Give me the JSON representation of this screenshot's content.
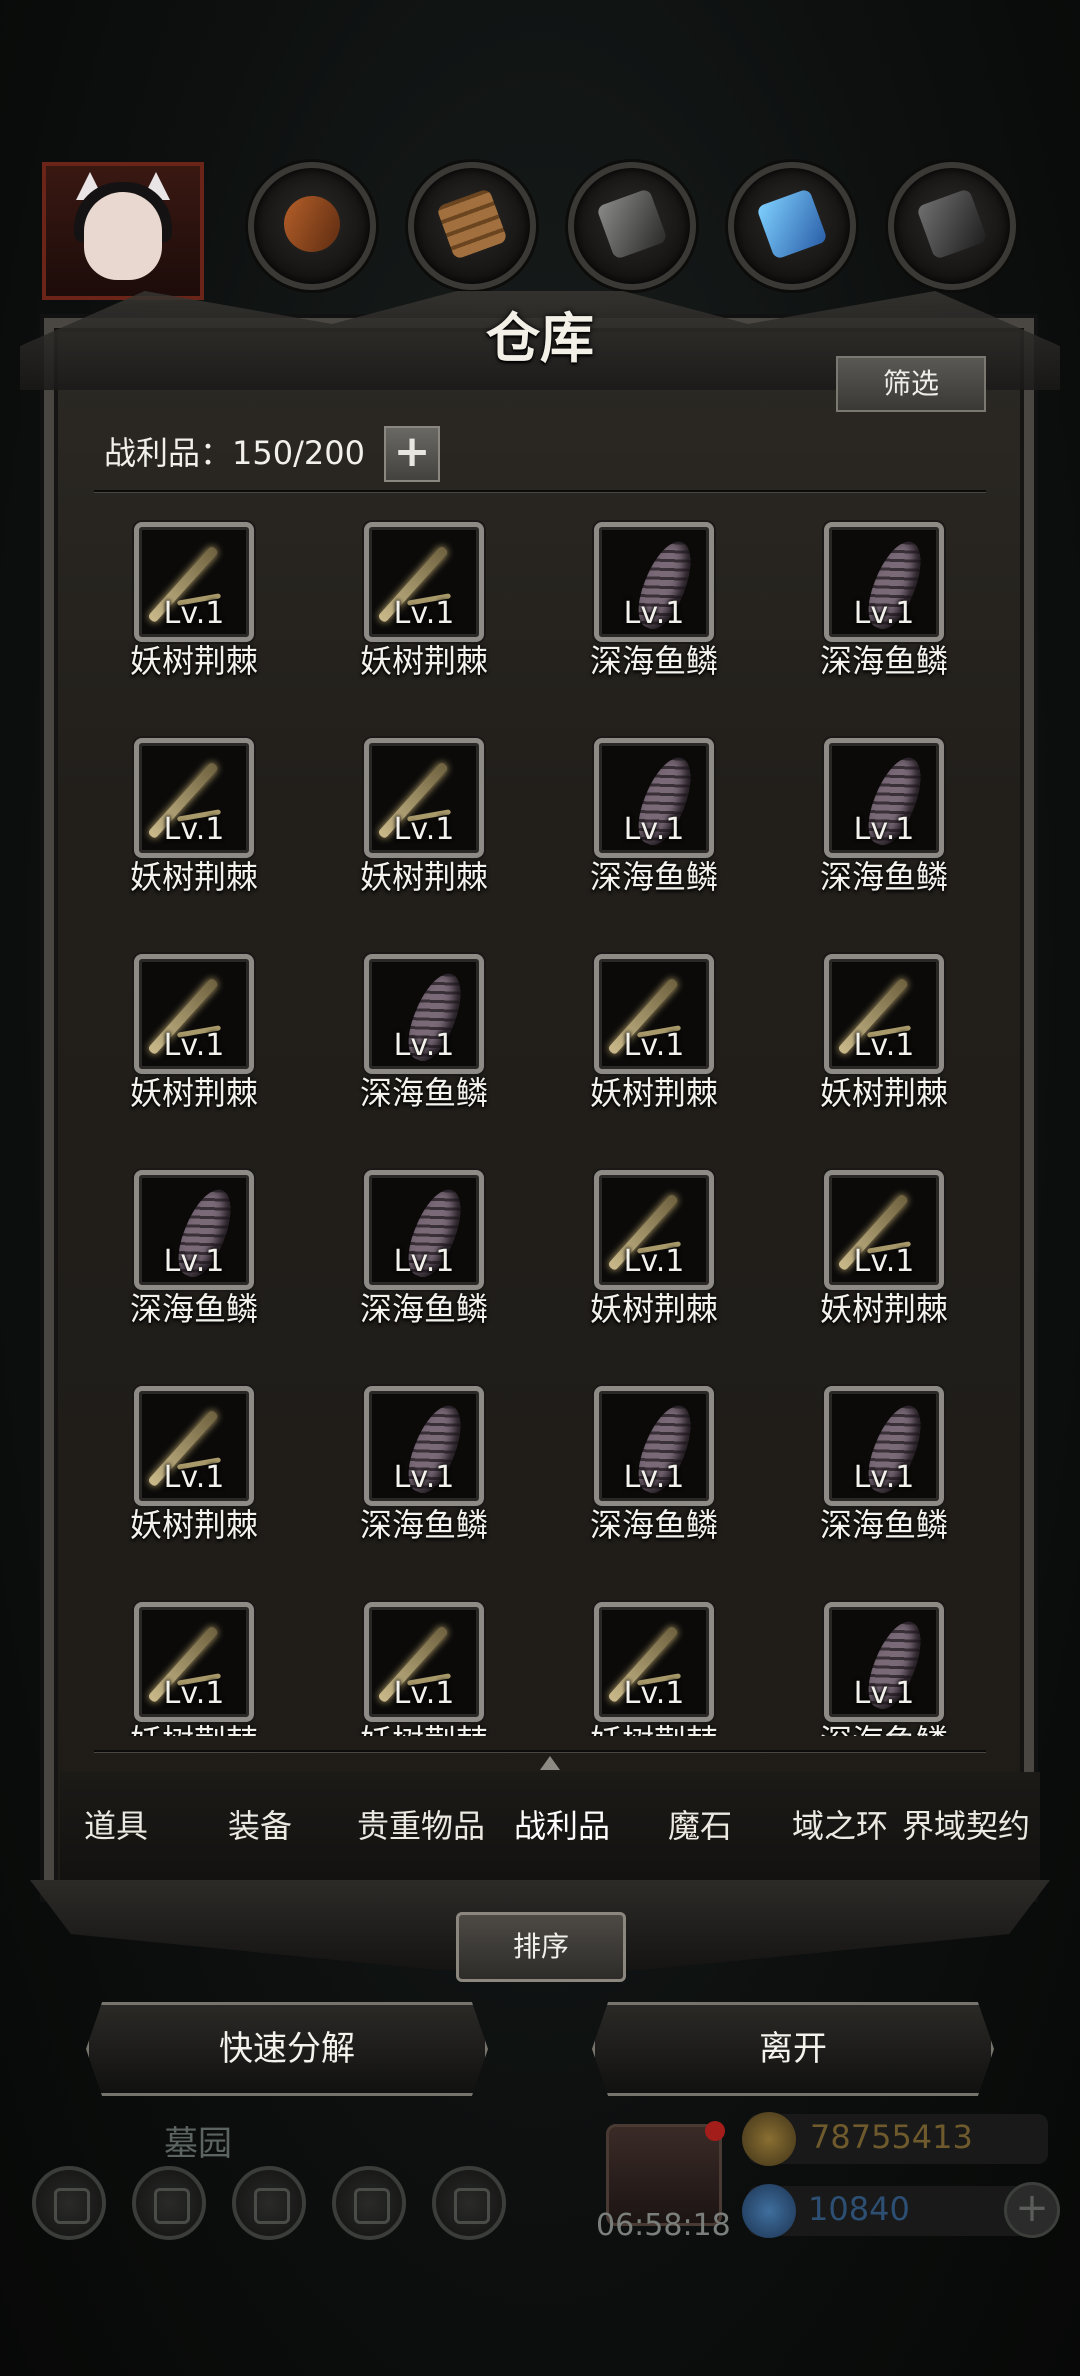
{
  "header": {
    "title": "仓库",
    "filter_label": "筛选"
  },
  "capacity": {
    "label": "战利品：150/200",
    "add_symbol": "+"
  },
  "top_icons": [
    "character-portrait",
    "ore-orb-icon",
    "wood-orb-icon",
    "iron-orb-icon",
    "crystal-orb-icon",
    "metal-orb-icon"
  ],
  "items": [
    {
      "level": "Lv.1",
      "name": "妖树荆棘",
      "icon": "thorn-icon"
    },
    {
      "level": "Lv.1",
      "name": "妖树荆棘",
      "icon": "thorn-icon"
    },
    {
      "level": "Lv.1",
      "name": "深海鱼鳞",
      "icon": "fish-scale-icon"
    },
    {
      "level": "Lv.1",
      "name": "深海鱼鳞",
      "icon": "fish-scale-icon"
    },
    {
      "level": "Lv.1",
      "name": "妖树荆棘",
      "icon": "thorn-icon"
    },
    {
      "level": "Lv.1",
      "name": "妖树荆棘",
      "icon": "thorn-icon"
    },
    {
      "level": "Lv.1",
      "name": "深海鱼鳞",
      "icon": "fish-scale-icon"
    },
    {
      "level": "Lv.1",
      "name": "深海鱼鳞",
      "icon": "fish-scale-icon"
    },
    {
      "level": "Lv.1",
      "name": "妖树荆棘",
      "icon": "thorn-icon"
    },
    {
      "level": "Lv.1",
      "name": "深海鱼鳞",
      "icon": "fish-scale-icon"
    },
    {
      "level": "Lv.1",
      "name": "妖树荆棘",
      "icon": "thorn-icon"
    },
    {
      "level": "Lv.1",
      "name": "妖树荆棘",
      "icon": "thorn-icon"
    },
    {
      "level": "Lv.1",
      "name": "深海鱼鳞",
      "icon": "fish-scale-icon"
    },
    {
      "level": "Lv.1",
      "name": "深海鱼鳞",
      "icon": "fish-scale-icon"
    },
    {
      "level": "Lv.1",
      "name": "妖树荆棘",
      "icon": "thorn-icon"
    },
    {
      "level": "Lv.1",
      "name": "妖树荆棘",
      "icon": "thorn-icon"
    },
    {
      "level": "Lv.1",
      "name": "妖树荆棘",
      "icon": "thorn-icon"
    },
    {
      "level": "Lv.1",
      "name": "深海鱼鳞",
      "icon": "fish-scale-icon"
    },
    {
      "level": "Lv.1",
      "name": "深海鱼鳞",
      "icon": "fish-scale-icon"
    },
    {
      "level": "Lv.1",
      "name": "深海鱼鳞",
      "icon": "fish-scale-icon"
    },
    {
      "level": "Lv.1",
      "name": "妖树荆棘",
      "icon": "thorn-icon"
    },
    {
      "level": "Lv.1",
      "name": "妖树荆棘",
      "icon": "thorn-icon"
    },
    {
      "level": "Lv.1",
      "name": "妖树荆棘",
      "icon": "thorn-icon"
    },
    {
      "level": "Lv.1",
      "name": "深海鱼鳞",
      "icon": "fish-scale-icon"
    }
  ],
  "tabs": [
    {
      "label": "道具"
    },
    {
      "label": "装备"
    },
    {
      "label": "贵重物品"
    },
    {
      "label": "战利品",
      "active": true
    },
    {
      "label": "魔石"
    },
    {
      "label": "域之环"
    },
    {
      "label": "界域契约"
    }
  ],
  "actions": {
    "sort_label": "排序",
    "decompose_label": "快速分解",
    "leave_label": "离开"
  },
  "background_hud": {
    "area_name": "墓园",
    "timer": "06:58:18",
    "gold": "78755413",
    "gems": "10840",
    "hud_icons": [
      "settings-icon",
      "star-icon",
      "book-icon",
      "mail-icon",
      "guild-icon"
    ],
    "colors": {
      "gold_text": "#6e5a2c",
      "gem_text": "#2e4f74"
    }
  }
}
